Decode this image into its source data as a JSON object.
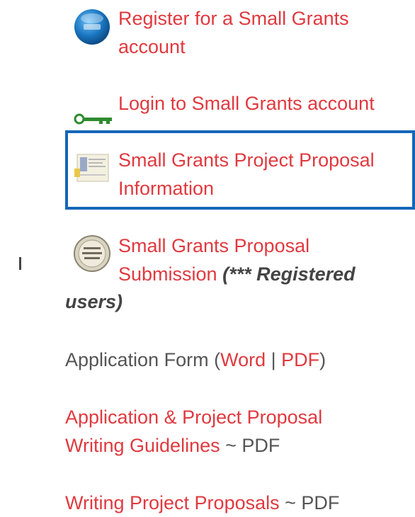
{
  "items": {
    "register": {
      "line1": "Register for a Small Grants",
      "line2": "account",
      "icon": "register-globe-icon"
    },
    "login": {
      "label": "Login to Small Grants account",
      "icon": "key-icon"
    },
    "info": {
      "line1": "Small Grants Project Proposal",
      "line2": "Information",
      "icon": "document-info-icon"
    },
    "submission": {
      "line1": "Small Grants Proposal",
      "line2": "Submission",
      "note_inline": "(*** Registered",
      "note_wrap": "users)",
      "icon": "submission-badge-icon"
    },
    "application_form": {
      "label": "Application Form (",
      "word": "Word",
      "separator": " | ",
      "pdf": "PDF",
      "close": ")"
    },
    "guidelines": {
      "line1": "Application & Project Proposal",
      "line2": "Writing Guidelines",
      "suffix": " ~ PDF"
    },
    "writing": {
      "label": "Writing Project Proposals",
      "suffix": " ~ PDF"
    }
  },
  "colors": {
    "link": "#e0393f",
    "text": "#555555",
    "highlight": "#1466b8"
  }
}
